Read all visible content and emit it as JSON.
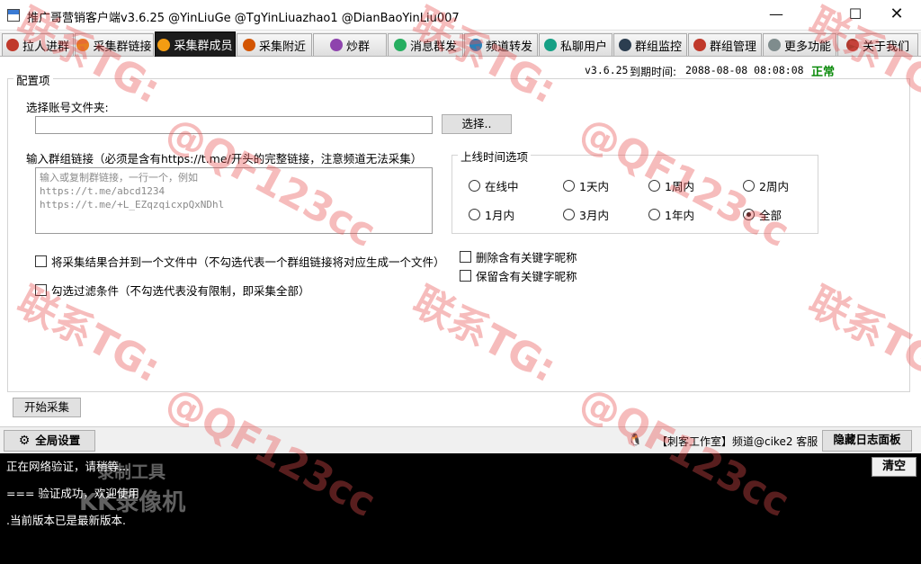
{
  "window": {
    "title": "推广哥营销客户端v3.6.25 @YinLiuGe @TgYinLiuazhao1 @DianBaoYinLiu007",
    "min_symbol": "—",
    "max_symbol": "☐",
    "close_symbol": "✕"
  },
  "tabs": [
    {
      "label": "拉人进群",
      "icon_color": "#c0392b"
    },
    {
      "label": "采集群链接",
      "icon_color": "#e67e22"
    },
    {
      "label": "采集群成员",
      "icon_color": "#f39c12",
      "active": true
    },
    {
      "label": "采集附近",
      "icon_color": "#d35400"
    },
    {
      "label": "炒群",
      "icon_color": "#8e44ad"
    },
    {
      "label": "消息群发",
      "icon_color": "#27ae60"
    },
    {
      "label": "频道转发",
      "icon_color": "#2980b9"
    },
    {
      "label": "私聊用户",
      "icon_color": "#16a085"
    },
    {
      "label": "群组监控",
      "icon_color": "#2c3e50"
    },
    {
      "label": "群组管理",
      "icon_color": "#c0392b"
    },
    {
      "label": "更多功能",
      "icon_color": "#7f8c8d"
    },
    {
      "label": "关于我们",
      "icon_color": "#b03a2e"
    }
  ],
  "header": {
    "version": "v3.6.25",
    "expiry_label": "到期时间:",
    "expiry_value": "2088-08-08 08:08:08",
    "status": "正常",
    "status_color": "#0a8a0a"
  },
  "config": {
    "group_title": "配置项",
    "folder_label": "选择账号文件夹:",
    "folder_value": "",
    "browse_label": "选择..",
    "link_label": "输入群组链接（必须是含有https://t.me/开头的完整链接，注意频道无法采集）",
    "link_placeholder_lines": [
      "输入或复制群链接，一行一个，例如",
      "https://t.me/abcd1234",
      "https://t.me/+L_EZqzqicxpQxNDhl"
    ],
    "online_group_title": "上线时间选项",
    "online_options": [
      {
        "label": "在线中",
        "checked": false
      },
      {
        "label": "1天内",
        "checked": false
      },
      {
        "label": "1周内",
        "checked": false
      },
      {
        "label": "2周内",
        "checked": false
      },
      {
        "label": "1月内",
        "checked": false
      },
      {
        "label": "3月内",
        "checked": false
      },
      {
        "label": "1年内",
        "checked": false
      },
      {
        "label": "全部",
        "checked": true
      }
    ],
    "merge_label": "将采集结果合并到一个文件中（不勾选代表一个群组链接将对应生成一个文件）",
    "filter_label": "勾选过滤条件（不勾选代表没有限制，即采集全部）",
    "remove_keyword_label": "删除含有关键字昵称",
    "keep_keyword_label": "保留含有关键字昵称",
    "start_label": "开始采集"
  },
  "bottom": {
    "global_settings_label": "全局设置",
    "support_text": "【刺客工作室】频道@cike2 客服",
    "hide_log_label": "隐藏日志面板"
  },
  "log": {
    "lines": [
      "正在网络验证，请稍等...",
      "===  验证成功，欢迎使用",
      ".当前版本已是最新版本."
    ],
    "clear_label": "清空",
    "rec_watermark_line1": "录制工具",
    "rec_watermark_line2": "KK录像机"
  },
  "watermark": {
    "line1": "联系TG:",
    "line2": "@QF123cc"
  }
}
